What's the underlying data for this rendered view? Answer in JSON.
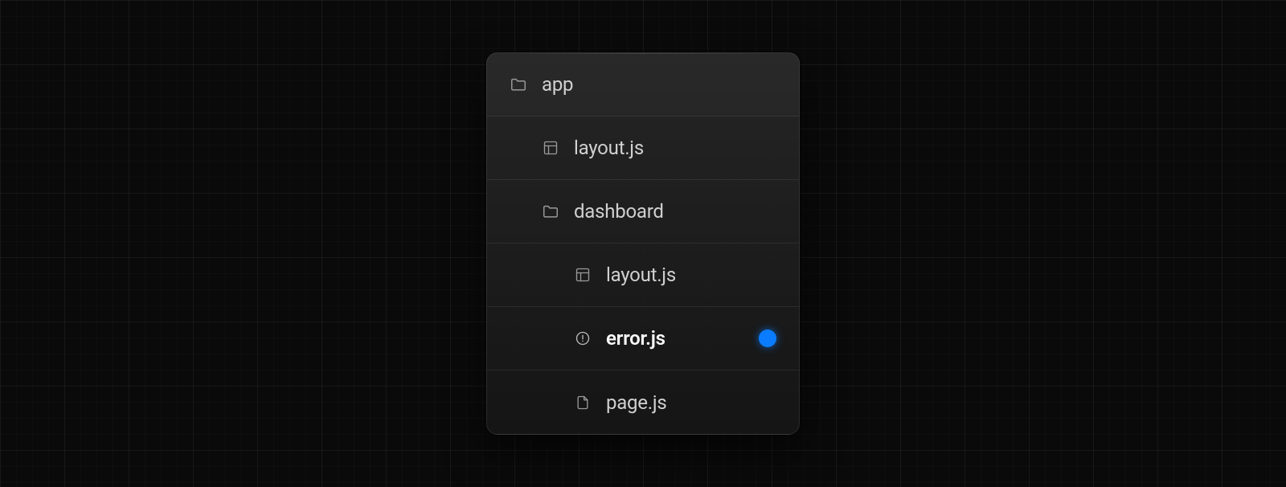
{
  "colors": {
    "accent_dot": "#0a7cff",
    "panel_border": "rgba(255,255,255,0.1)",
    "text_default": "#d0d0d0",
    "text_active": "#fafafa",
    "icon": "#9a9a9a",
    "background": "#0a0a0a"
  },
  "tree": {
    "items": [
      {
        "label": "app",
        "icon": "folder",
        "depth": 0,
        "active": false,
        "dot": false
      },
      {
        "label": "layout.js",
        "icon": "layout",
        "depth": 1,
        "active": false,
        "dot": false
      },
      {
        "label": "dashboard",
        "icon": "folder",
        "depth": 1,
        "active": false,
        "dot": false
      },
      {
        "label": "layout.js",
        "icon": "layout",
        "depth": 2,
        "active": false,
        "dot": false
      },
      {
        "label": "error.js",
        "icon": "error",
        "depth": 2,
        "active": true,
        "dot": true
      },
      {
        "label": "page.js",
        "icon": "file",
        "depth": 2,
        "active": false,
        "dot": false
      }
    ]
  }
}
